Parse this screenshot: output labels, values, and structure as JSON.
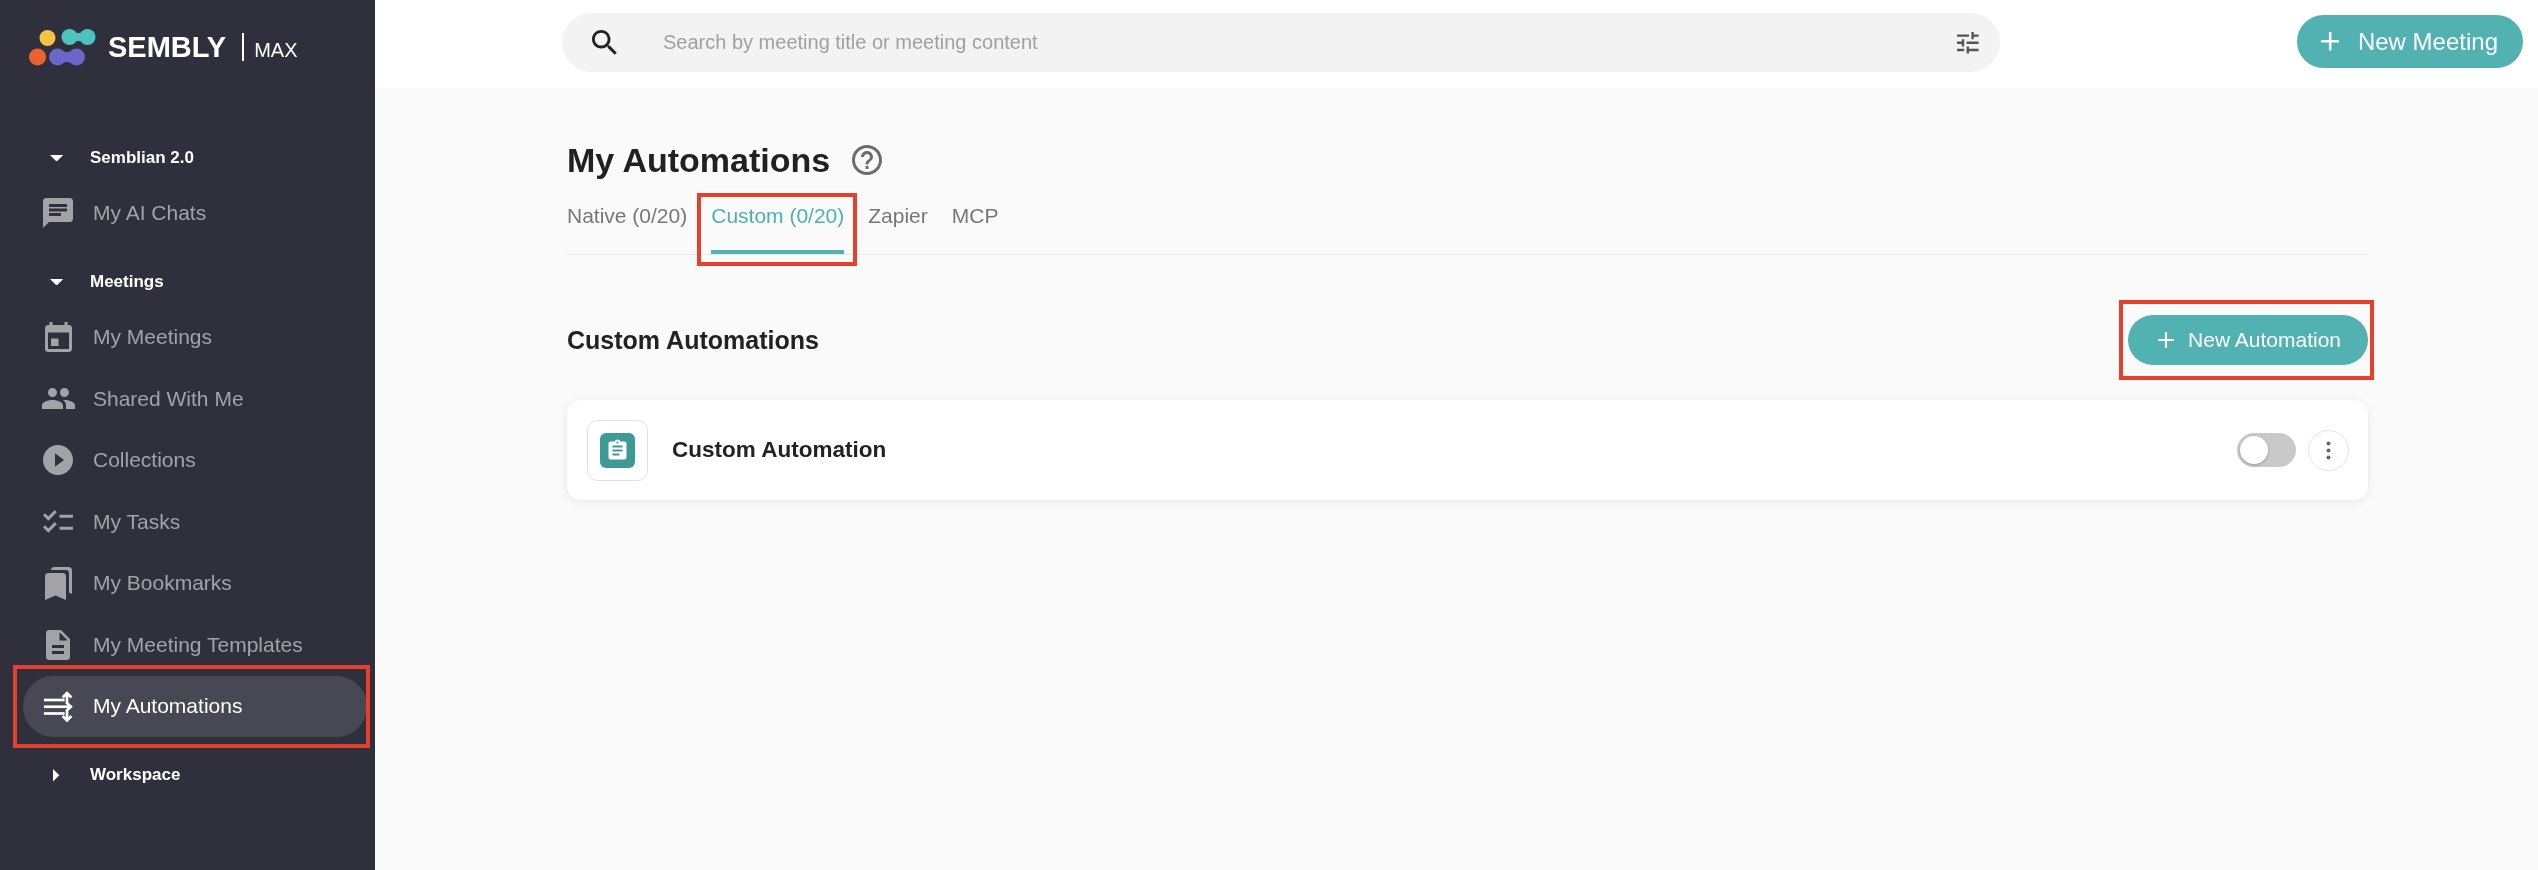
{
  "logo": {
    "wordmark": "SEMBLY",
    "plan": "MAX"
  },
  "sidebar": {
    "sections": [
      {
        "title": "Semblian 2.0",
        "expanded": true,
        "items": [
          {
            "label": "My AI Chats",
            "selected": false,
            "highlighted": false
          }
        ]
      },
      {
        "title": "Meetings",
        "expanded": true,
        "items": [
          {
            "label": "My Meetings",
            "selected": false,
            "highlighted": false
          },
          {
            "label": "Shared With Me",
            "selected": false,
            "highlighted": false
          },
          {
            "label": "Collections",
            "selected": false,
            "highlighted": false
          },
          {
            "label": "My Tasks",
            "selected": false,
            "highlighted": false
          },
          {
            "label": "My Bookmarks",
            "selected": false,
            "highlighted": false
          },
          {
            "label": "My Meeting Templates",
            "selected": false,
            "highlighted": false
          },
          {
            "label": "My Automations",
            "selected": true,
            "highlighted": true
          }
        ]
      },
      {
        "title": "Workspace",
        "expanded": false
      }
    ]
  },
  "search": {
    "placeholder": "Search by meeting title or meeting content"
  },
  "new_meeting_button": {
    "label": "New Meeting"
  },
  "page": {
    "title": "My Automations",
    "tabs": [
      {
        "label": "Native (0/20)",
        "selected": false,
        "highlighted": false
      },
      {
        "label": "Custom (0/20)",
        "selected": true,
        "highlighted": true
      },
      {
        "label": "Zapier",
        "selected": false,
        "highlighted": false
      },
      {
        "label": "MCP",
        "selected": false,
        "highlighted": false
      }
    ],
    "section_title": "Custom Automations",
    "new_automation_button": {
      "label": "New Automation",
      "highlighted": true
    },
    "automations": [
      {
        "name": "Custom Automation",
        "on": false
      }
    ]
  }
}
